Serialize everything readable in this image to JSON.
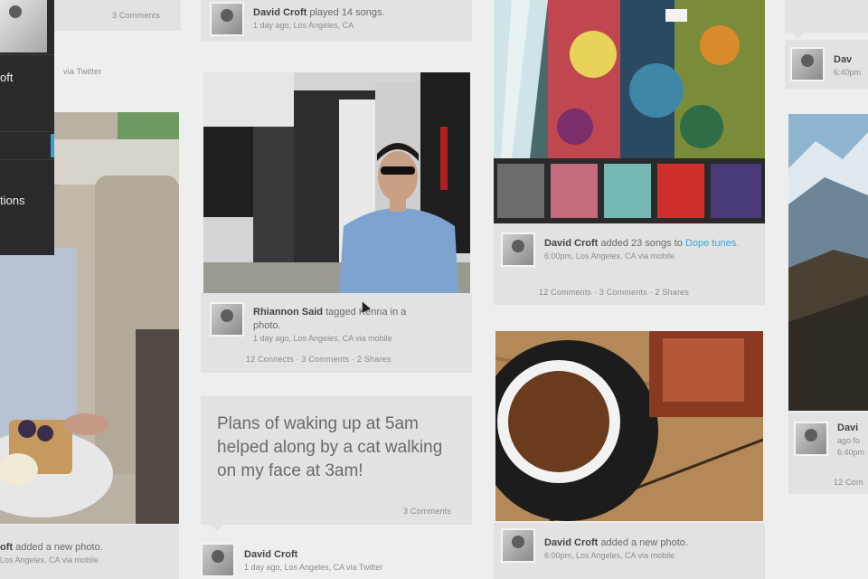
{
  "colors": {
    "page_bg": "#eeeeee",
    "card_bg": "#e2e2e2",
    "sidebar_bg": "#2a2a2a",
    "accent": "#2f9fd6",
    "link": "#3aa6d8"
  },
  "sidebar": {
    "items": [
      {
        "label": "oft"
      },
      {
        "label": ""
      },
      {
        "label": "tions"
      }
    ]
  },
  "col1": {
    "top_counts": "3 Comments",
    "top_via": "via Twitter",
    "bottom_post": {
      "author": "oft",
      "action": "added a new photo.",
      "sub": "Los Angeles, CA via mobile"
    }
  },
  "col2": {
    "played_post": {
      "author": "David Croft",
      "action": "played 14 songs.",
      "sub": "1 day ago, Los Angeles, CA"
    },
    "tag_post": {
      "author": "Rhiannon Said",
      "action_a": "tagged Kenna in a",
      "action_b": "photo.",
      "sub": "1 day ago, Los Angeles, CA via mobile",
      "counts": "12 Connects  ·  3 Comments  ·  2 Shares"
    },
    "text_post": {
      "text_lines": [
        "Plans of waking up at 5am",
        "helped along by a cat walking",
        "on my face at 3am!"
      ],
      "counts": "3 Comments"
    },
    "bottom_post": {
      "author": "David Croft",
      "sub": "1 day ago, Los Angeles, CA via Twitter"
    }
  },
  "col3": {
    "songs_post": {
      "author": "David Croft",
      "action": "added 23 songs to",
      "link": "Dope tunes.",
      "sub": "6:00pm, Los Angeles, CA via mobile",
      "counts": "12 Comments  ·  3 Comments  ·  2 Shares"
    },
    "photo_post": {
      "author": "David Croft",
      "action": "added a new photo.",
      "sub": "6:00pm, Los Angeles, CA via mobile"
    }
  },
  "col4": {
    "top_post": {
      "author": "Dav",
      "sub": "6:40pm"
    },
    "bottom_post": {
      "author": "Davi",
      "sub_a": "ago fo",
      "sub_b": "6:40pm",
      "counts": "12 Com"
    }
  }
}
